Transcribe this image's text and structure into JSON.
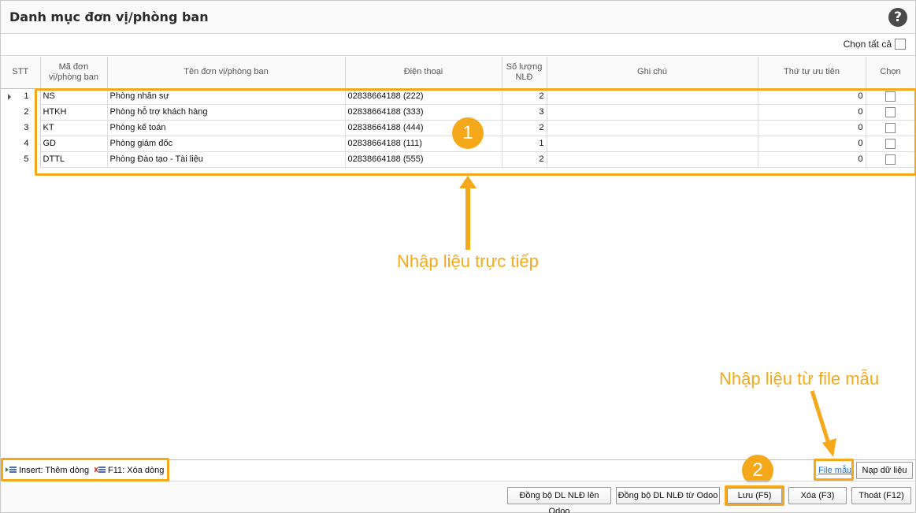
{
  "window": {
    "title": "Danh mục đơn vị/phòng ban",
    "help_glyph": "?"
  },
  "toolbar": {
    "select_all_label": "Chọn tất cả"
  },
  "table": {
    "headers": {
      "stt": "STT",
      "code": [
        "Mã đơn",
        "vị/phòng ban"
      ],
      "name": "Tên đơn vị/phòng ban",
      "phone": "Điện thoại",
      "count": [
        "Số lượng",
        "NLĐ"
      ],
      "note": "Ghi chú",
      "priority": "Thứ tự ưu tiên",
      "select": "Chọn"
    },
    "rows": [
      {
        "stt": "1",
        "code": "NS",
        "name": "Phòng nhân sự",
        "phone": "02838664188 (222)",
        "count": "2",
        "note": "",
        "priority": "0",
        "selected": false
      },
      {
        "stt": "2",
        "code": "HTKH",
        "name": "Phòng hỗ trợ khách hàng",
        "phone": "02838664188 (333)",
        "count": "3",
        "note": "",
        "priority": "0",
        "selected": false
      },
      {
        "stt": "3",
        "code": "KT",
        "name": "Phòng kế toán",
        "phone": "02838664188 (444)",
        "count": "2",
        "note": "",
        "priority": "0",
        "selected": false
      },
      {
        "stt": "4",
        "code": "GD",
        "name": "Phòng giám đốc",
        "phone": "02838664188 (111)",
        "count": "1",
        "note": "",
        "priority": "0",
        "selected": false
      },
      {
        "stt": "5",
        "code": "DTTL",
        "name": "Phòng Đào tạo - Tài liệu",
        "phone": "02838664188 (555)",
        "count": "2",
        "note": "",
        "priority": "0",
        "selected": false
      }
    ]
  },
  "annotations": {
    "badge_1": "1",
    "badge_2": "2",
    "direct_entry": "Nhập liệu trực tiếp",
    "template_entry": "Nhập liệu từ file mẫu",
    "color": "#f5a91a"
  },
  "statusbar": {
    "insert_hint": "Insert: Thêm dòng",
    "delete_hint": "F11: Xóa dòng",
    "template_link": "File mẫu",
    "load_button": "Nạp dữ liệu"
  },
  "footer": {
    "sync_up": "Đồng bộ DL NLĐ lên Odoo",
    "sync_down": "Đồng bộ DL NLĐ từ Odoo",
    "save": "Lưu (F5)",
    "delete": "Xóa (F3)",
    "exit": "Thoát (F12)"
  },
  "icons": [
    "help-icon",
    "row-indicator-icon",
    "insert-row-icon",
    "delete-row-icon"
  ]
}
